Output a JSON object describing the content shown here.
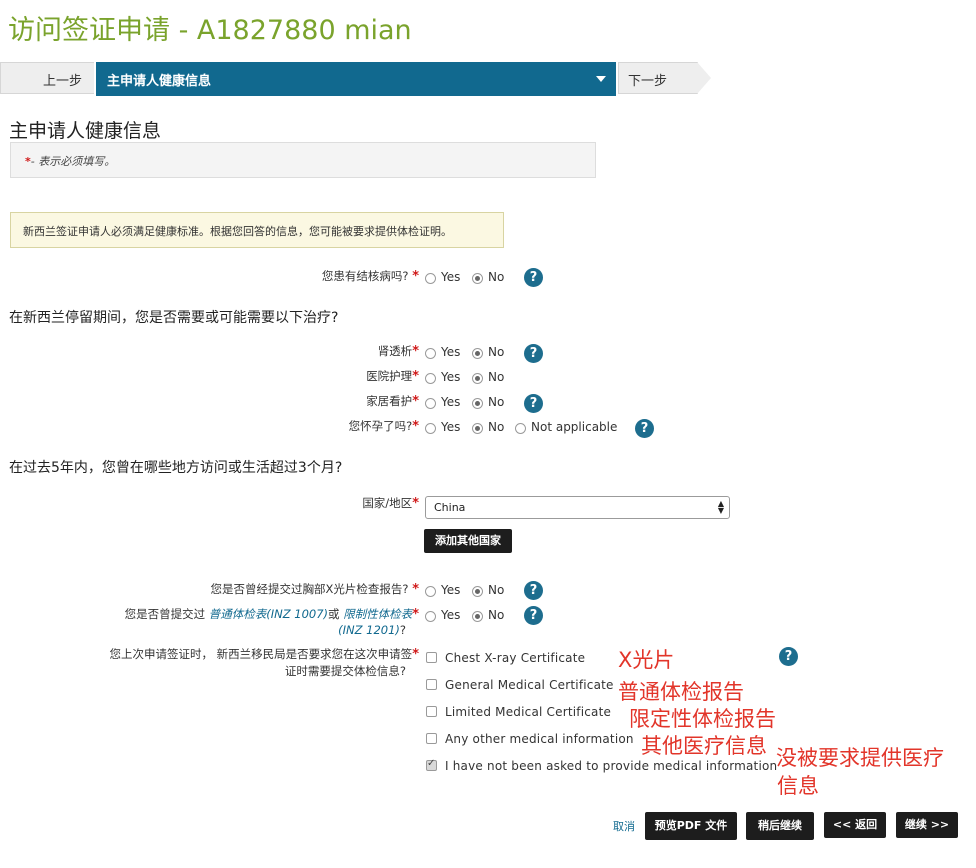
{
  "page_title": "访问签证申请 - A1827880 mian",
  "wizard": {
    "prev_label": "上一步",
    "current_step": "主申请人健康信息",
    "next_label": "下一步"
  },
  "section_title": "主申请人健康信息",
  "required_note": {
    "star": "*",
    "text": "- 表示必须填写。"
  },
  "notice": "新西兰签证申请人必须满足健康标准。根据您回答的信息，您可能被要求提供体检证明。",
  "options": {
    "yes": "Yes",
    "no": "No",
    "na": "Not applicable"
  },
  "q_tb": {
    "label": "您患有结核病吗?",
    "selected": "No"
  },
  "treatment_heading": "在新西兰停留期间，您是否需要或可能需要以下治疗?",
  "q_dialysis": {
    "label": "肾透析",
    "selected": "No"
  },
  "q_hospital": {
    "label": "医院护理",
    "selected": "No"
  },
  "q_homecare": {
    "label": "家居看护",
    "selected": "No"
  },
  "q_pregnant": {
    "label": "您怀孕了吗?",
    "selected": "No"
  },
  "residence_heading": "在过去5年内，您曾在哪些地方访问或生活超过3个月?",
  "country": {
    "label": "国家/地区",
    "value": "China",
    "add_button": "添加其他国家"
  },
  "q_xray": {
    "label": "您是否曾经提交过胸部X光片检查报告?",
    "selected": "No"
  },
  "q_medical": {
    "prefix": "您是否曾提交过",
    "link1": "普通体检表(INZ 1007)",
    "or": "或",
    "link2": "限制性体检表",
    "line2_link": "(INZ 1201)",
    "line2_suffix": "?",
    "selected": "No"
  },
  "q_prev": {
    "line1": "您上次申请签证时， 新西兰移民局是否要求您在这次申请签",
    "line2": "证时需要提交体检信息?",
    "checkboxes": [
      {
        "label": "Chest X-ray Certificate",
        "checked": false
      },
      {
        "label": "General Medical Certificate",
        "checked": false
      },
      {
        "label": "Limited Medical Certificate",
        "checked": false
      },
      {
        "label": "Any other medical information",
        "checked": false
      },
      {
        "label": "I have not been asked to provide medical information",
        "checked": true
      }
    ]
  },
  "annotations": {
    "xray": "X光片",
    "general": "普通体检报告",
    "limited": "限定性体检报告",
    "other": "其他医疗信息",
    "not_asked_1": "没被要求提供医疗",
    "not_asked_2": "信息"
  },
  "footer": {
    "cancel": "取消",
    "preview_pdf": "预览PDF 文件",
    "save_later": "稍后继续",
    "back": "<< 返回",
    "continue": "继续 >>"
  },
  "colors": {
    "title_green": "#7aa32c",
    "wizard_blue": "#11698f",
    "help_blue": "#1d6d8e",
    "required_red": "#d01a1a",
    "annotation_red": "#e2352a"
  }
}
